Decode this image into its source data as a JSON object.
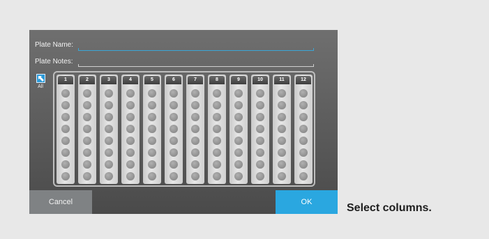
{
  "form": {
    "plate_name_label": "Plate Name:",
    "plate_name_value": "",
    "plate_notes_label": "Plate Notes:",
    "plate_notes_value": ""
  },
  "select_all": {
    "label": "All",
    "icon": "select-all-arrow-icon"
  },
  "columns": [
    "1",
    "2",
    "3",
    "4",
    "5",
    "6",
    "7",
    "8",
    "9",
    "10",
    "11",
    "12"
  ],
  "wells_per_column": 8,
  "buttons": {
    "cancel": "Cancel",
    "ok": "OK"
  },
  "caption": "Select columns.",
  "colors": {
    "accent": "#2aa7e0",
    "panel": "#5b5b5b",
    "cancel": "#7f8284"
  }
}
